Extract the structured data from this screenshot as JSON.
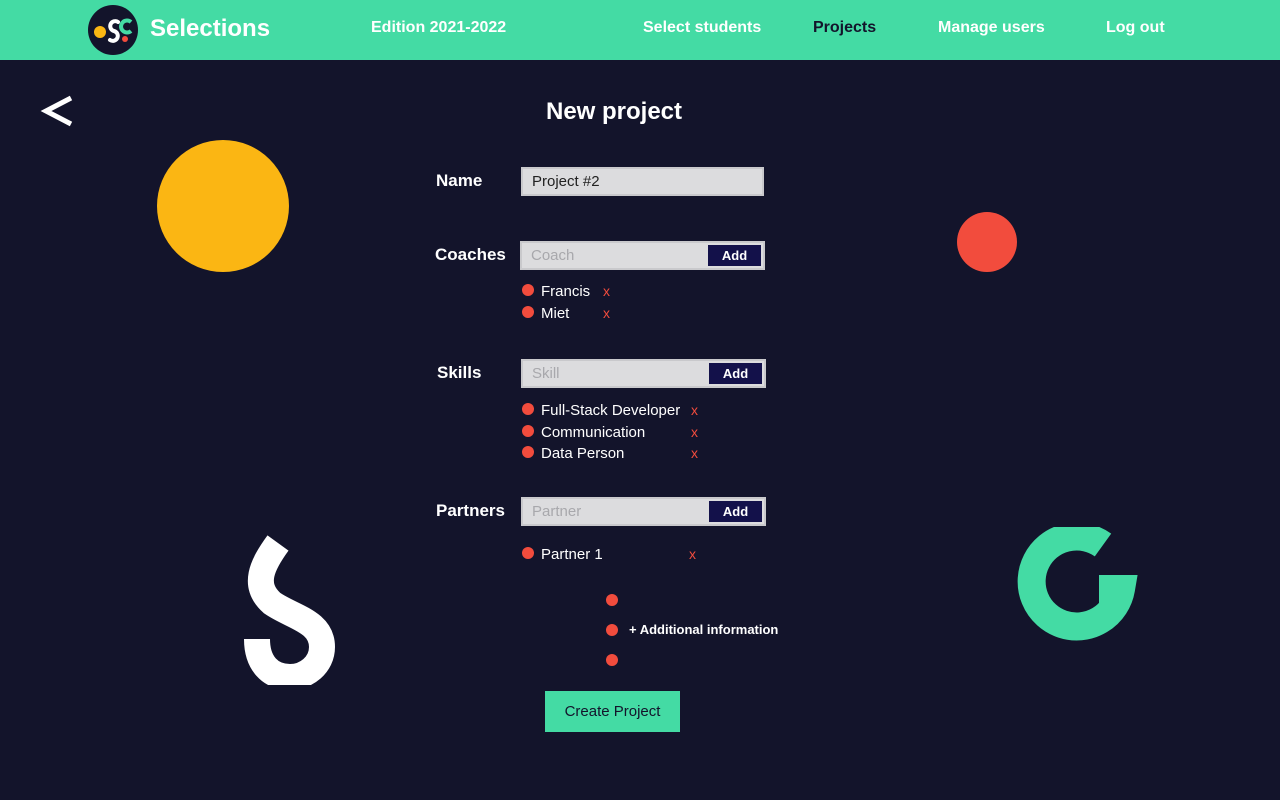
{
  "app": {
    "brand": "Selections",
    "edition": "Edition 2021-2022"
  },
  "nav": {
    "select_students": "Select students",
    "projects": "Projects",
    "manage_users": "Manage users",
    "log_out": "Log out",
    "active": "Projects"
  },
  "page": {
    "title": "New project"
  },
  "form": {
    "name": {
      "label": "Name",
      "value": "Project #2"
    },
    "coaches": {
      "label": "Coaches",
      "placeholder": "Coach",
      "add_label": "Add",
      "items": [
        "Francis",
        "Miet"
      ]
    },
    "skills": {
      "label": "Skills",
      "placeholder": "Skill",
      "add_label": "Add",
      "items": [
        "Full-Stack Developer",
        "Communication",
        "Data Person"
      ]
    },
    "partners": {
      "label": "Partners",
      "placeholder": "Partner",
      "add_label": "Add",
      "items": [
        "Partner 1"
      ]
    },
    "remove_label": "x",
    "additional_info": "+ Additional information",
    "submit_label": "Create Project"
  },
  "icons": {
    "logo": "osoc-logo-icon",
    "back": "chevron-left-icon"
  },
  "colors": {
    "nav_bg": "#44dba4",
    "page_bg": "#13142b",
    "accent_red": "#f24c3d",
    "accent_yellow": "#fbb613",
    "button_dark": "#13114a"
  }
}
